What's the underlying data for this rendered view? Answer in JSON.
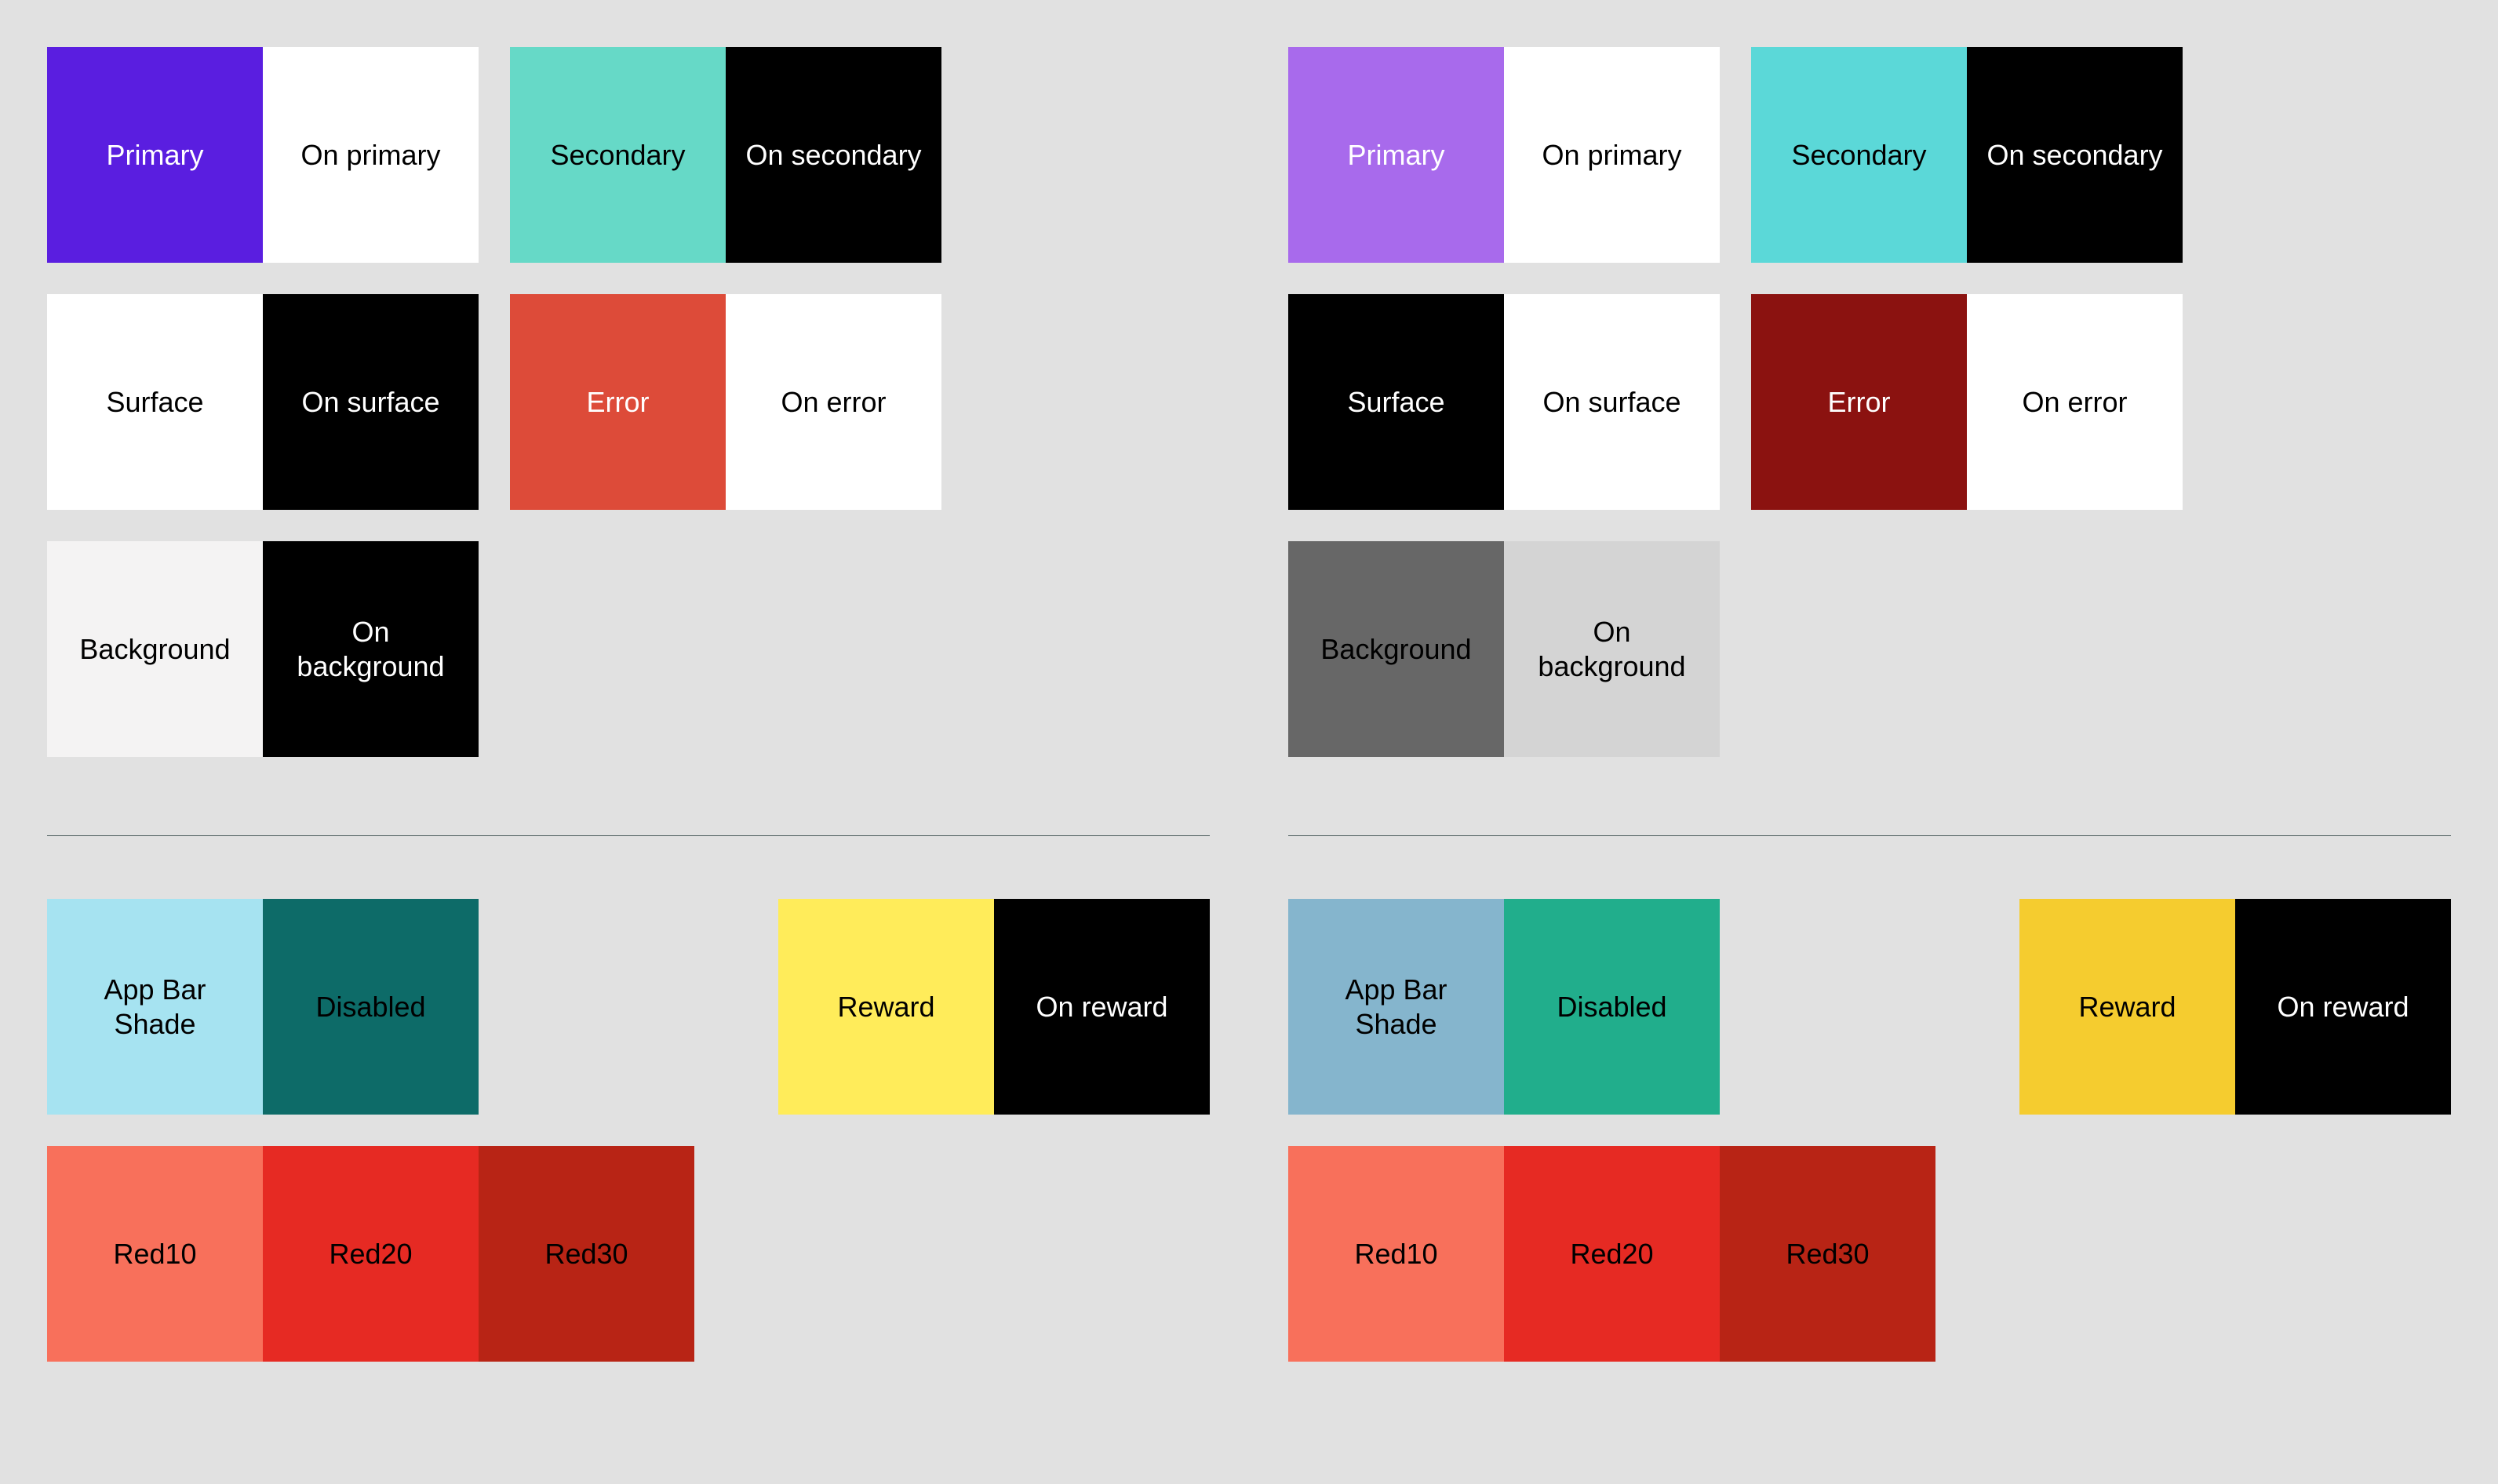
{
  "labels": {
    "primary": "Primary",
    "on_primary": "On primary",
    "secondary": "Secondary",
    "on_secondary": "On secondary",
    "surface": "Surface",
    "on_surface": "On surface",
    "error": "Error",
    "on_error": "On error",
    "background": "Background",
    "on_background": "On background",
    "app_bar_shade": "App Bar Shade",
    "disabled": "Disabled",
    "reward": "Reward",
    "on_reward": "On reward",
    "red10": "Red10",
    "red20": "Red20",
    "red30": "Red30"
  },
  "left": {
    "primary_bg": "#5a1ee0",
    "primary_fg": "#ffffff",
    "on_primary_bg": "#ffffff",
    "on_primary_fg": "#000000",
    "secondary_bg": "#66d9c7",
    "secondary_fg": "#000000",
    "on_secondary_bg": "#000000",
    "on_secondary_fg": "#ffffff",
    "surface_bg": "#ffffff",
    "surface_fg": "#000000",
    "on_surface_bg": "#000000",
    "on_surface_fg": "#ffffff",
    "error_bg": "#dd4b39",
    "error_fg": "#ffffff",
    "on_error_bg": "#ffffff",
    "on_error_fg": "#000000",
    "background_bg": "#f4f3f3",
    "background_fg": "#000000",
    "on_background_bg": "#000000",
    "on_background_fg": "#ffffff",
    "appbar_bg": "#a6e3f1",
    "appbar_fg": "#000000",
    "disabled_bg": "#0d6b68",
    "disabled_fg": "#000000",
    "reward_bg": "#ffec5a",
    "reward_fg": "#000000",
    "on_reward_bg": "#000000",
    "on_reward_fg": "#ffffff",
    "red10_bg": "#f8705b",
    "red10_fg": "#000000",
    "red20_bg": "#e62a23",
    "red20_fg": "#000000",
    "red30_bg": "#b82415",
    "red30_fg": "#000000"
  },
  "right": {
    "primary_bg": "#a86aec",
    "primary_fg": "#ffffff",
    "on_primary_bg": "#ffffff",
    "on_primary_fg": "#000000",
    "secondary_bg": "#5bd8d8",
    "secondary_fg": "#000000",
    "on_secondary_bg": "#000000",
    "on_secondary_fg": "#ffffff",
    "surface_bg": "#000000",
    "surface_fg": "#ffffff",
    "on_surface_bg": "#ffffff",
    "on_surface_fg": "#000000",
    "error_bg": "#8b1210",
    "error_fg": "#ffffff",
    "on_error_bg": "#ffffff",
    "on_error_fg": "#000000",
    "background_bg": "#676767",
    "background_fg": "#000000",
    "on_background_bg": "#d4d4d4",
    "on_background_fg": "#000000",
    "appbar_bg": "#85b5cd",
    "appbar_fg": "#000000",
    "disabled_bg": "#21ae8c",
    "disabled_fg": "#000000",
    "reward_bg": "#f5cc2f",
    "reward_fg": "#000000",
    "on_reward_bg": "#000000",
    "on_reward_fg": "#ffffff",
    "red10_bg": "#f8705b",
    "red10_fg": "#000000",
    "red20_bg": "#e62a23",
    "red20_fg": "#000000",
    "red30_bg": "#b82415",
    "red30_fg": "#000000"
  }
}
